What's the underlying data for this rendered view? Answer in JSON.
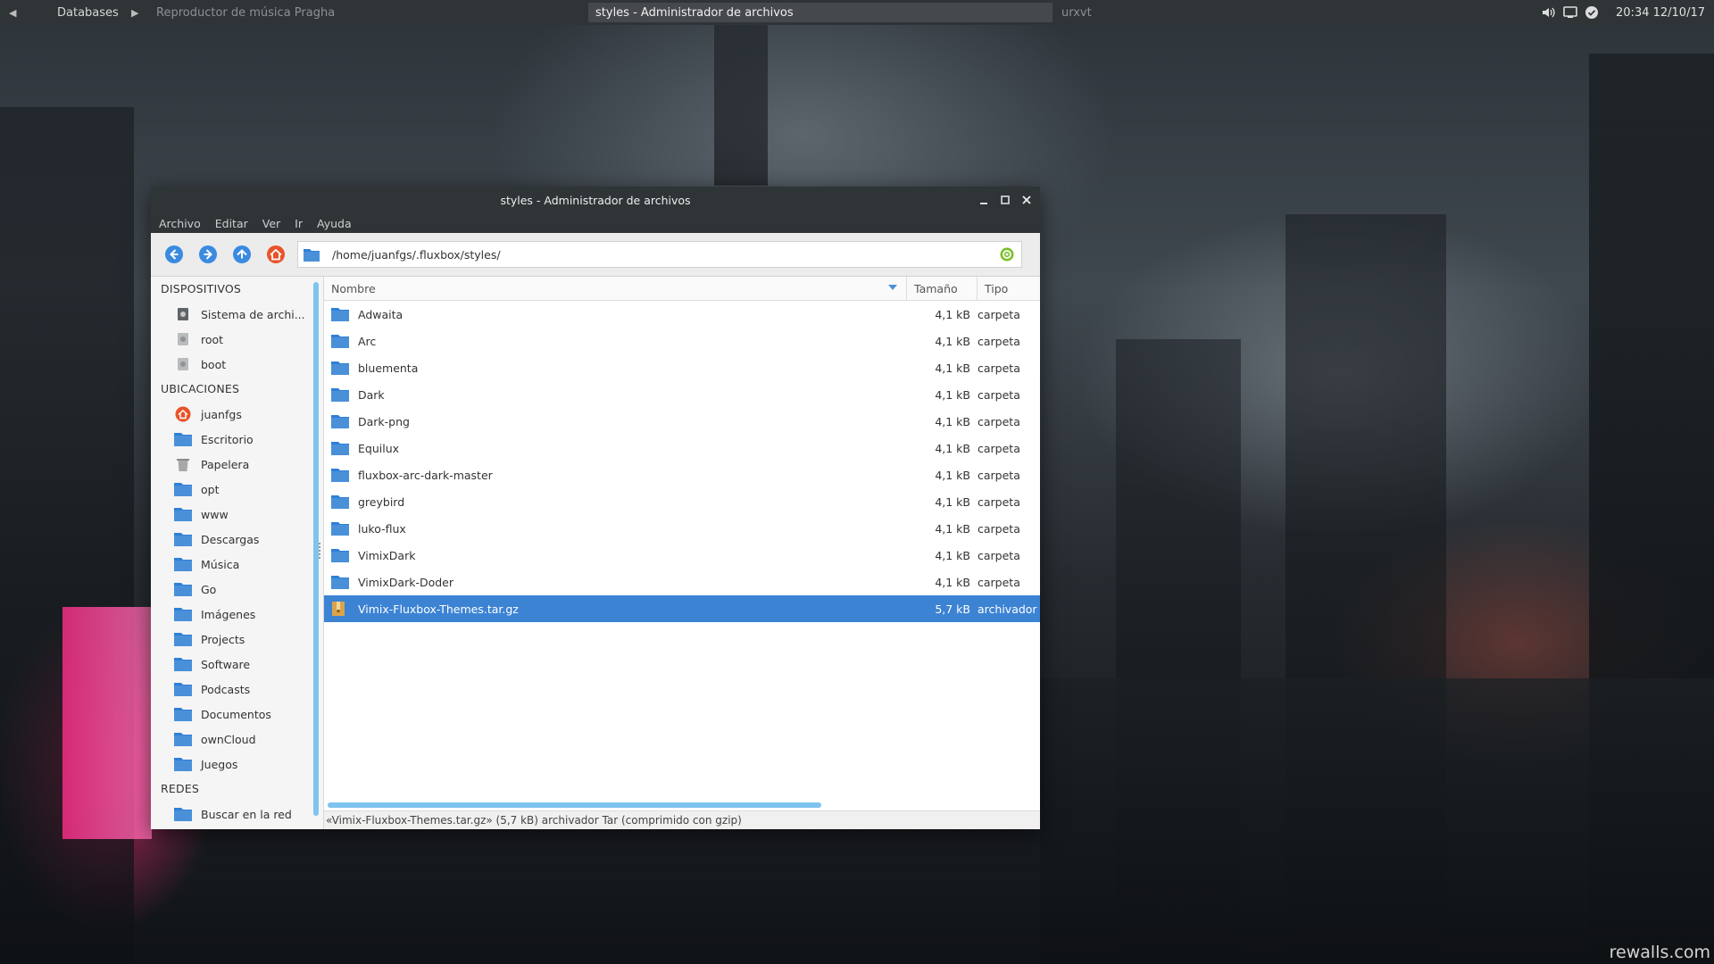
{
  "panel": {
    "tasks": [
      "Databases",
      "Reproductor de música Pragha",
      "styles - Administrador de archivos",
      "urxvt"
    ],
    "clock": "20:34 12/10/17"
  },
  "window": {
    "title": "styles - Administrador de archivos",
    "menu": [
      "Archivo",
      "Editar",
      "Ver",
      "Ir",
      "Ayuda"
    ],
    "address": "/home/juanfgs/.fluxbox/styles/"
  },
  "sidebar": {
    "devices_heading": "DISPOSITIVOS",
    "devices": [
      "Sistema de archi...",
      "root",
      "boot"
    ],
    "places_heading": "UBICACIONES",
    "places": [
      "juanfgs",
      "Escritorio",
      "Papelera",
      "opt",
      "www",
      "Descargas",
      "Música",
      "Go",
      "Imágenes",
      "Projects",
      "Software",
      "Podcasts",
      "Documentos",
      "ownCloud",
      "Juegos"
    ],
    "network_heading": "REDES",
    "network": [
      "Buscar en la red"
    ]
  },
  "columns": {
    "name": "Nombre",
    "size": "Tamaño",
    "type": "Tipo"
  },
  "files": [
    {
      "name": "Adwaita",
      "size": "4,1 kB",
      "type": "carpeta"
    },
    {
      "name": "Arc",
      "size": "4,1 kB",
      "type": "carpeta"
    },
    {
      "name": "bluementa",
      "size": "4,1 kB",
      "type": "carpeta"
    },
    {
      "name": "Dark",
      "size": "4,1 kB",
      "type": "carpeta"
    },
    {
      "name": "Dark-png",
      "size": "4,1 kB",
      "type": "carpeta"
    },
    {
      "name": "Equilux",
      "size": "4,1 kB",
      "type": "carpeta"
    },
    {
      "name": "fluxbox-arc-dark-master",
      "size": "4,1 kB",
      "type": "carpeta"
    },
    {
      "name": "greybird",
      "size": "4,1 kB",
      "type": "carpeta"
    },
    {
      "name": "luko-flux",
      "size": "4,1 kB",
      "type": "carpeta"
    },
    {
      "name": "VimixDark",
      "size": "4,1 kB",
      "type": "carpeta"
    },
    {
      "name": "VimixDark-Doder",
      "size": "4,1 kB",
      "type": "carpeta"
    },
    {
      "name": "Vimix-Fluxbox-Themes.tar.gz",
      "size": "5,7 kB",
      "type": "archivador"
    }
  ],
  "status": "«Vimix-Fluxbox-Themes.tar.gz» (5,7 kB) archivador Tar (comprimido con gzip)",
  "watermark": "rewalls.com",
  "colors": {
    "selection": "#3c83d4",
    "folder": "#4a90d9",
    "panel": "#2f3437",
    "scroll": "#7ec4ee"
  }
}
